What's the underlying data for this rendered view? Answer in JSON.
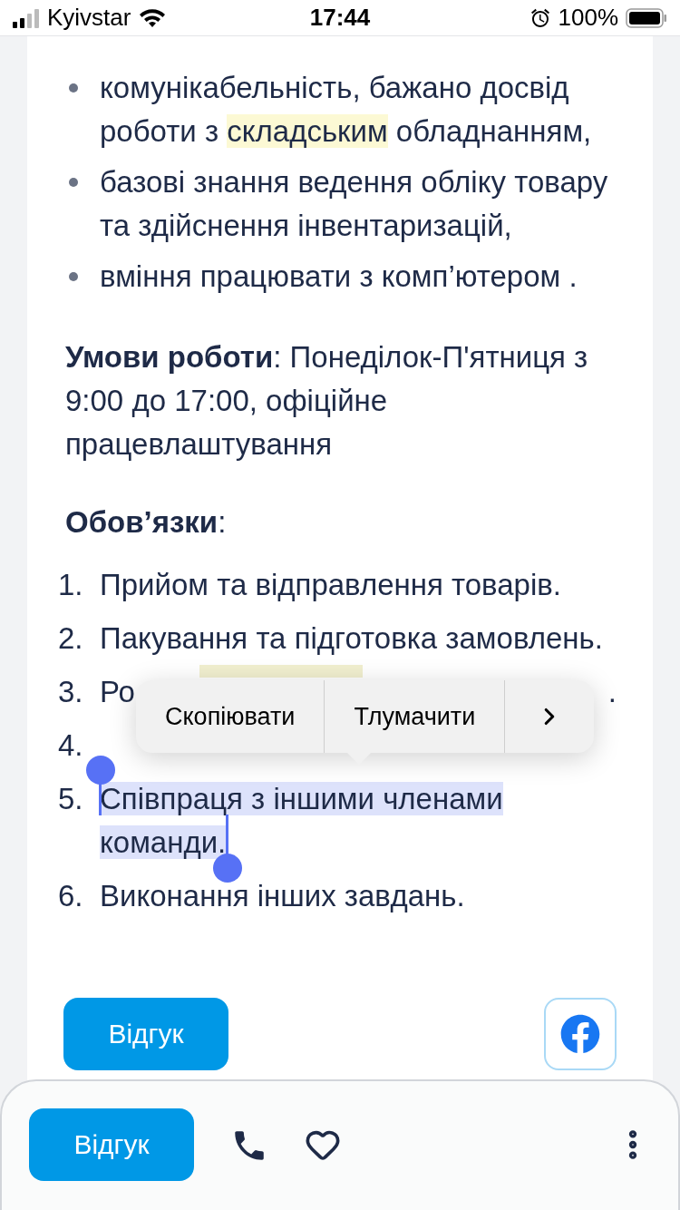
{
  "status_bar": {
    "carrier": "Kyivstar",
    "time": "17:44",
    "battery": "100%"
  },
  "requirements": {
    "bullets": [
      {
        "parts": [
          {
            "text": "комунікабельність, бажано досвід роботи з ",
            "highlight": false
          },
          {
            "text": "складським",
            "highlight": true
          },
          {
            "text": " обладнанням,",
            "highlight": false
          }
        ]
      },
      {
        "parts": [
          {
            "text": "базові знання ведення обліку товару та здійснення інвентаризацій,",
            "highlight": false
          }
        ]
      },
      {
        "parts": [
          {
            "text": "вміння працювати з комп’ютером .",
            "highlight": false
          }
        ]
      }
    ]
  },
  "conditions": "**Умови роботи**: Понеділок-П'ятниця з 9:00 до 17:00, офіційне працевлаштування",
  "duties": {
    "heading": "**Обов’язки**:",
    "items": [
      {
        "kind": "text",
        "number": "1.",
        "text": "Прийом та відправлення товарів.",
        "selected": false
      },
      {
        "kind": "text",
        "number": "2.",
        "text": "Пакування та підготовка замовлень.",
        "selected": false
      },
      {
        "kind": "covered",
        "number": "3.",
        "start": "Ро",
        "end": ".",
        "selected": false
      },
      {
        "kind": "hidden",
        "number": "4.",
        "selected": false
      },
      {
        "kind": "text",
        "number": "5.",
        "text": "Співпраця з іншими членами команди.",
        "selected": true
      },
      {
        "kind": "text",
        "number": "6.",
        "text": "Виконання інших завдань.",
        "selected": false
      }
    ]
  },
  "context_menu": {
    "items": [
      "Скопіювати",
      "Тлумачити"
    ]
  },
  "actions": {
    "apply": "Відгук"
  },
  "bottom_bar": {
    "apply": "Відгук"
  }
}
